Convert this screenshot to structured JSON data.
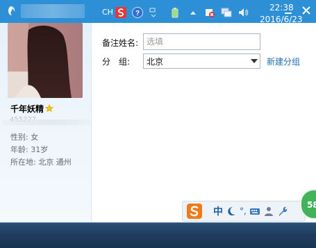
{
  "window": {
    "title_icon": "qq-penguin-icon",
    "minimize_icon": "minimize-icon",
    "close_icon": "close-icon"
  },
  "profile": {
    "nickname": "千年妖精",
    "star_icon": "star-icon",
    "qq_number_partial": "455227",
    "gender": "性别: 女",
    "age": "年龄: 31岁",
    "location": "所在地: 北京 通州"
  },
  "form": {
    "remark_label": "备注姓名:",
    "remark_value": "",
    "remark_placeholder": "选填",
    "group_label": "分　组:",
    "group_value": "北京",
    "new_group_link": "新建分组"
  },
  "ime": {
    "logo": "sogou-s-icon",
    "mode": "中",
    "badge": "58"
  },
  "taskbar": {
    "lang": "CH",
    "time": "22:38",
    "date": "2016/6/23"
  },
  "colors": {
    "titlebar": "#2d8fd6",
    "link": "#1e6fb8",
    "taskbar": "#1f3d5f",
    "badge": "#43b35a"
  }
}
